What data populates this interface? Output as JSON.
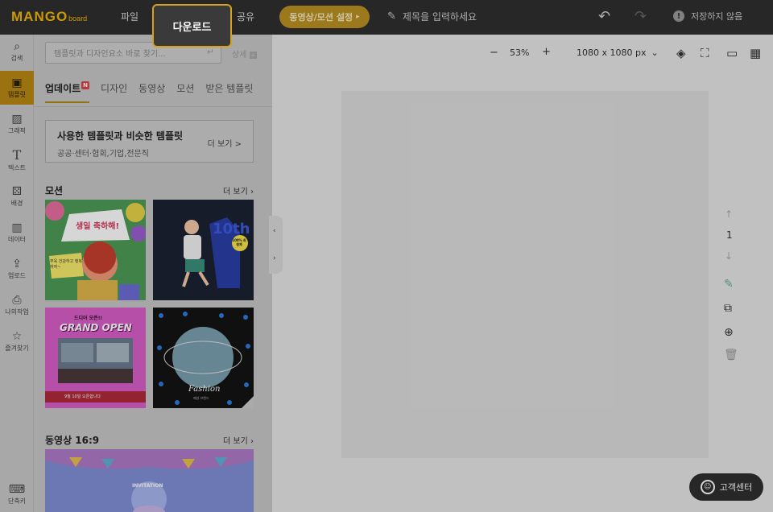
{
  "logo": {
    "main": "MANGO",
    "sub": "board"
  },
  "menu": {
    "file": "파일",
    "download": "다운로드",
    "share": "공유"
  },
  "motion_button": {
    "label": "동영상/모션 설정",
    "arrow": "▸"
  },
  "title_input": {
    "placeholder": "제목을 입력하세요"
  },
  "save_status": {
    "label": "저장하지 않음",
    "icon": "!"
  },
  "rail": [
    {
      "icon": "⌕",
      "label": "검색"
    },
    {
      "icon": "▣",
      "label": "템플릿"
    },
    {
      "icon": "▨",
      "label": "그래픽"
    },
    {
      "icon": "T",
      "label": "텍스트"
    },
    {
      "icon": "⚄",
      "label": "배경"
    },
    {
      "icon": "▥",
      "label": "데이터"
    },
    {
      "icon": "⇪",
      "label": "업로드"
    },
    {
      "icon": "⎙",
      "label": "나의작업"
    },
    {
      "icon": "☆",
      "label": "즐겨찾기"
    },
    {
      "icon": "⌨",
      "label": "단축키"
    }
  ],
  "panel": {
    "search_placeholder": "템플릿과 디자인요소 바로 찾기...",
    "detail": "상세",
    "tabs": [
      "업데이트",
      "디자인",
      "동영상",
      "모션",
      "받은 템플릿"
    ],
    "badge": "N",
    "similar": {
      "title": "사용한 템플릿과 비슷한 템플릿",
      "sub": "공공·센터·협회,기업,전문직",
      "more": "더 보기 >"
    },
    "sections": [
      {
        "title": "모션",
        "more": "더 보기"
      },
      {
        "title": "동영상 16:9",
        "more": "더 보기"
      }
    ],
    "thumbs": {
      "t1": {
        "text": "생일 축하해!",
        "sub": "쭈욱 건강하고 행복하자~"
      },
      "t2": {
        "text": "10th",
        "badge": "100% 회원제"
      },
      "t3": {
        "text": "GRAND OPEN",
        "top": "드디어 오픈!!",
        "bottom": "9월 10일 오픈합니다"
      },
      "t4": {
        "text": "Fashion",
        "sub": "패션 브랜드"
      },
      "t5": {
        "text": "INVITATION"
      }
    }
  },
  "canvas": {
    "zoom": "53%",
    "size": "1080 x 1080 px",
    "page_number": "1"
  },
  "customer_center": {
    "label": "고객센터"
  },
  "colors": {
    "accent": "#f2b705",
    "topbar": "#2f2f2f",
    "motion": "#b99122"
  }
}
